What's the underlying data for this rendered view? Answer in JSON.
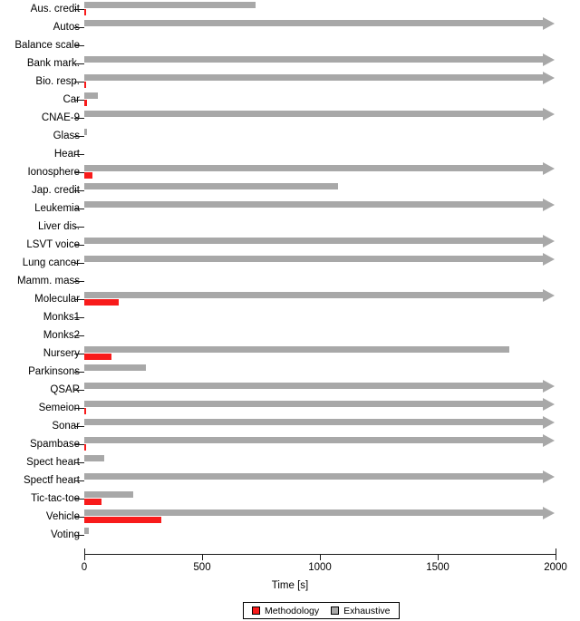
{
  "chart_data": {
    "type": "bar",
    "orientation": "horizontal",
    "title": "",
    "xlabel": "Time [s]",
    "ylabel": "",
    "xlim": [
      0,
      2000
    ],
    "xticks": [
      0,
      500,
      1000,
      1500,
      2000
    ],
    "xtick_labels": [
      "0",
      "500",
      "1000",
      "1500",
      "2000"
    ],
    "grid": false,
    "legend_position": "bottom-center",
    "note": "Bars ending in an arrowhead exceed the 2000 s axis limit (truncated, drawn dash-dotted).",
    "categories": [
      "Aus. credit",
      "Autos",
      "Balance scale",
      "Bank mark.",
      "Bio. resp.",
      "Car",
      "CNAE-9",
      "Glass",
      "Heart",
      "Ionosphere",
      "Jap. credit",
      "Leukemia",
      "Liver dis.",
      "LSVT voice",
      "Lung cancer",
      "Mamm. mass",
      "Molecular",
      "Monks1",
      "Monks2",
      "Nursery",
      "Parkinsons",
      "QSAR",
      "Semeion",
      "Sonar",
      "Spambase",
      "Spect heart",
      "Spectf heart",
      "Tic-tac-toe",
      "Vehicle",
      "Voting"
    ],
    "series": [
      {
        "name": "Exhaustive",
        "color": "#a8a8a8",
        "values": [
          728,
          2000,
          0,
          2000,
          2000,
          57,
          2000,
          12,
          0,
          2000,
          1077,
          2000,
          0,
          2000,
          2000,
          0,
          2000,
          0,
          0,
          1804,
          262,
          2000,
          2000,
          2000,
          2000,
          85,
          2000,
          208,
          2000,
          20
        ],
        "truncated": [
          false,
          true,
          false,
          true,
          true,
          false,
          true,
          false,
          false,
          true,
          false,
          true,
          false,
          true,
          true,
          false,
          true,
          false,
          false,
          false,
          false,
          true,
          true,
          true,
          true,
          false,
          true,
          false,
          true,
          false
        ]
      },
      {
        "name": "Methodology",
        "color": "#f81b1b",
        "values": [
          9,
          0,
          0,
          0,
          7,
          10,
          0,
          0,
          0,
          35,
          0,
          0,
          0,
          0,
          0,
          0,
          146,
          0,
          0,
          115,
          0,
          0,
          3,
          0,
          4,
          0,
          0,
          73,
          327,
          0
        ],
        "truncated": [
          false,
          false,
          false,
          false,
          false,
          false,
          false,
          false,
          false,
          false,
          false,
          false,
          false,
          false,
          false,
          false,
          false,
          false,
          false,
          false,
          false,
          false,
          false,
          false,
          false,
          false,
          false,
          false,
          false,
          false
        ]
      }
    ],
    "legend": [
      {
        "label": "Methodology",
        "color": "#f81b1b"
      },
      {
        "label": "Exhaustive",
        "color": "#a8a8a8"
      }
    ]
  }
}
